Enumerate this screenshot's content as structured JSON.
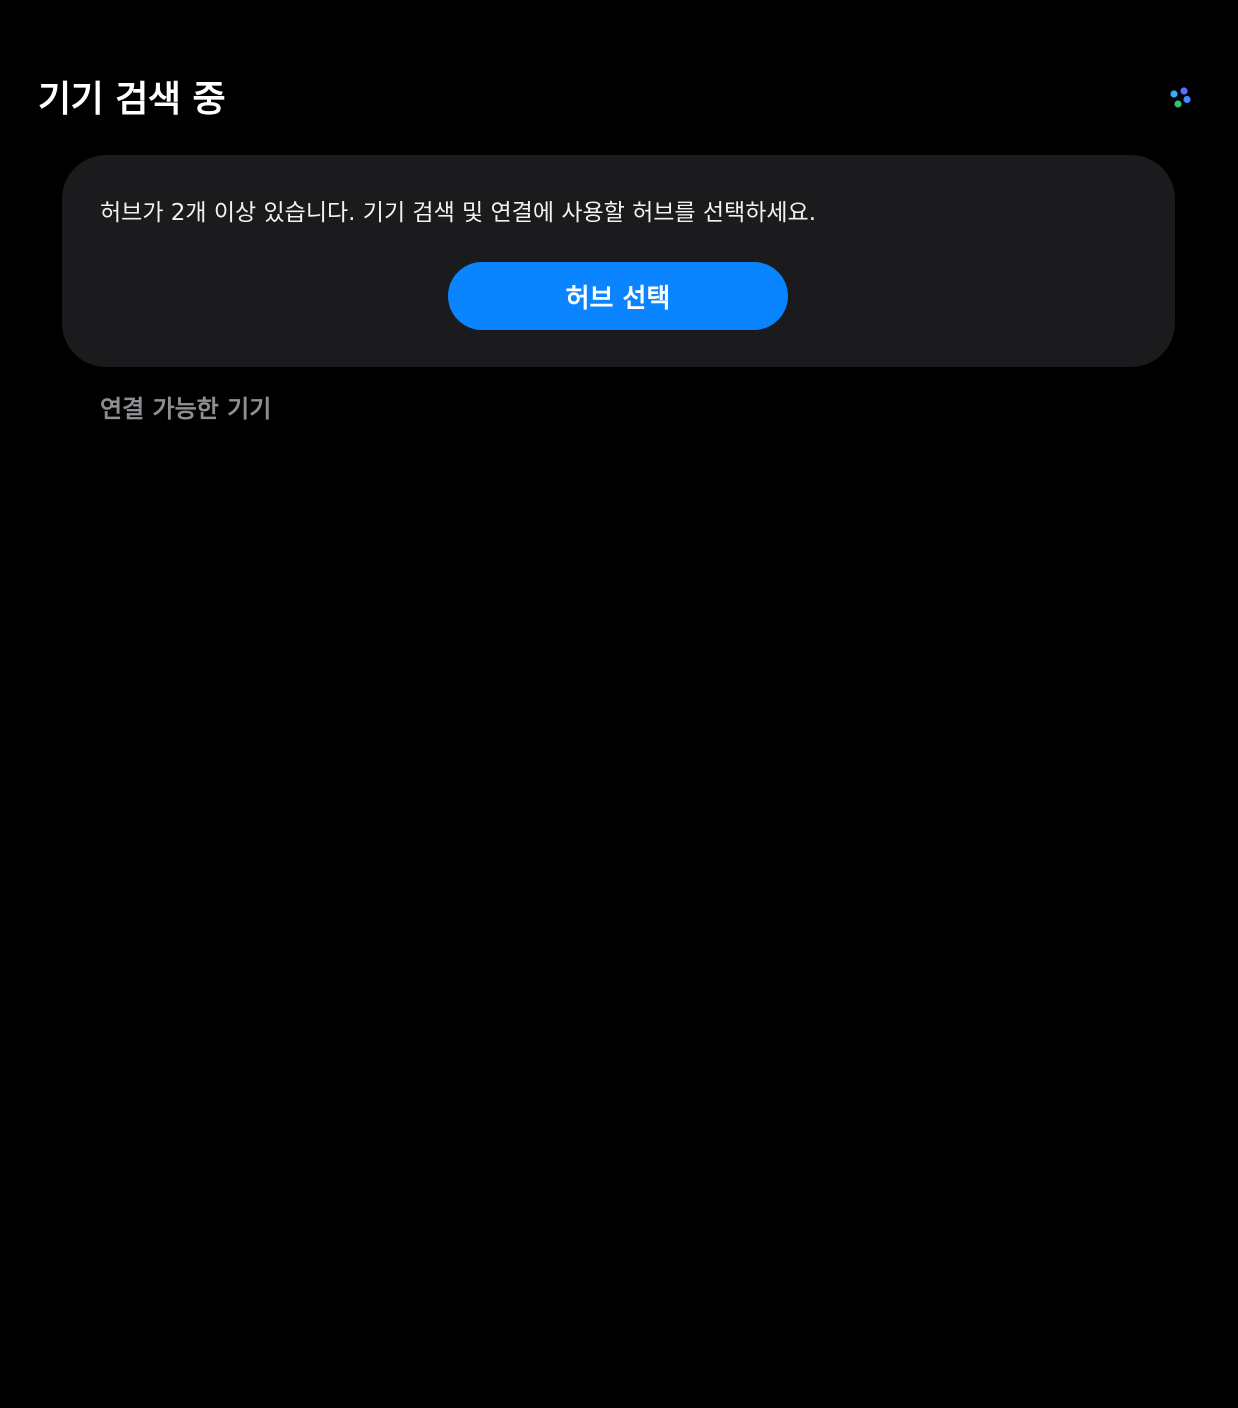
{
  "header": {
    "title": "기기 검색 중",
    "scan_icon": "scanning-dots-icon",
    "scan_icon_colors": [
      "#3ea8ff",
      "#5b6cff",
      "#2fc07a",
      "#3d8bff"
    ]
  },
  "hub_card": {
    "message": "허브가 2개 이상 있습니다. 기기 검색 및 연결에 사용할 허브를 선택하세요.",
    "button_label": "허브 선택",
    "button_color": "#0a84ff",
    "card_color": "#1b1b1d"
  },
  "available_devices": {
    "section_title": "연결 가능한 기기",
    "items": []
  }
}
